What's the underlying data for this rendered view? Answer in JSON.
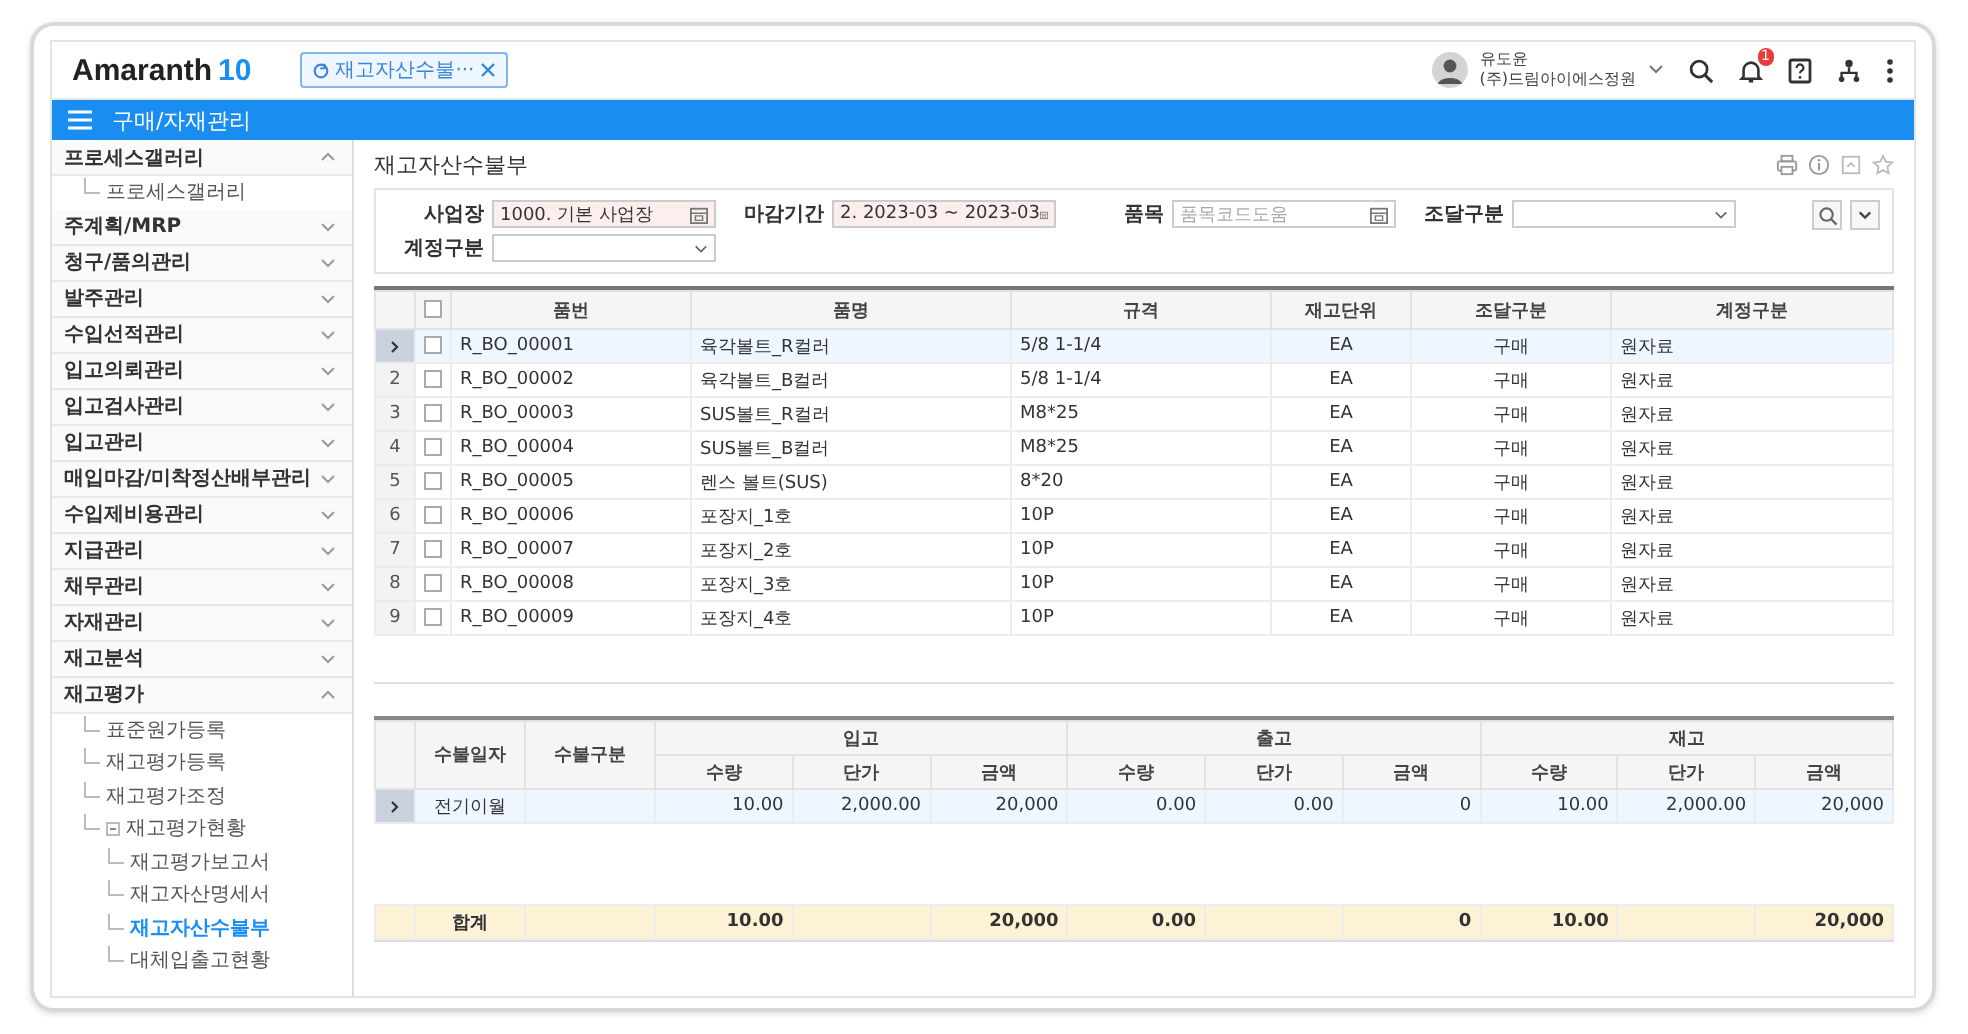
{
  "app": {
    "logo_name": "Amaranth",
    "logo_version": "10"
  },
  "open_tab": {
    "label": "재고자산수불···"
  },
  "user": {
    "name": "유도윤",
    "company": "(주)드림아이에스정원"
  },
  "notification_count": "1",
  "module_title": "구매/자재관리",
  "sidebar": {
    "items": [
      {
        "label": "프로세스갤러리",
        "expanded": true,
        "children": [
          {
            "label": "프로세스갤러리",
            "selected": false
          }
        ]
      },
      {
        "label": "주계획/MRP",
        "expanded": false
      },
      {
        "label": "청구/품의관리",
        "expanded": false
      },
      {
        "label": "발주관리",
        "expanded": false
      },
      {
        "label": "수입선적관리",
        "expanded": false
      },
      {
        "label": "입고의뢰관리",
        "expanded": false
      },
      {
        "label": "입고검사관리",
        "expanded": false
      },
      {
        "label": "입고관리",
        "expanded": false
      },
      {
        "label": "매입마감/미착정산배부관리",
        "expanded": false
      },
      {
        "label": "수입제비용관리",
        "expanded": false
      },
      {
        "label": "지급관리",
        "expanded": false
      },
      {
        "label": "채무관리",
        "expanded": false
      },
      {
        "label": "자재관리",
        "expanded": false
      },
      {
        "label": "재고분석",
        "expanded": false
      },
      {
        "label": "재고평가",
        "expanded": true,
        "children": [
          {
            "label": "표준원가등록",
            "selected": false
          },
          {
            "label": "재고평가등록",
            "selected": false
          },
          {
            "label": "재고평가조정",
            "selected": false
          },
          {
            "label": "재고평가현황",
            "expanded": true,
            "selected": false,
            "children": [
              {
                "label": "재고평가보고서",
                "selected": false
              },
              {
                "label": "재고자산명세서",
                "selected": false
              },
              {
                "label": "재고자산수불부",
                "selected": true
              },
              {
                "label": "대체입출고현황",
                "selected": false
              }
            ]
          }
        ]
      }
    ]
  },
  "page_title": "재고자산수불부",
  "filters": [
    {
      "label": "사업장",
      "kind": "picker",
      "value": "1000. 기본 사업장",
      "required": true
    },
    {
      "label": "마감기간",
      "kind": "picker",
      "value": "2. 2023-03 ~ 2023-03",
      "required": true
    },
    {
      "label": "품목",
      "kind": "picker",
      "placeholder": "품목코드도움",
      "required": false
    },
    {
      "label": "조달구분",
      "kind": "select",
      "required": false
    },
    {
      "label": "계정구분",
      "kind": "select",
      "required": false
    }
  ],
  "items_table": {
    "columns": [
      "품번",
      "품명",
      "규격",
      "재고단위",
      "조달구분",
      "계정구분"
    ],
    "header_checked": false,
    "rows": [
      {
        "selected": true,
        "checked": false,
        "cells": [
          "R_BO_00001",
          "육각볼트_R컬러",
          "5/8 1-1/4",
          "EA",
          "구매",
          "원자료"
        ]
      },
      {
        "no": "2",
        "selected": false,
        "checked": false,
        "cells": [
          "R_BO_00002",
          "육각볼트_B컬러",
          "5/8 1-1/4",
          "EA",
          "구매",
          "원자료"
        ]
      },
      {
        "no": "3",
        "selected": false,
        "checked": false,
        "cells": [
          "R_BO_00003",
          "SUS볼트_R컬러",
          "M8*25",
          "EA",
          "구매",
          "원자료"
        ]
      },
      {
        "no": "4",
        "selected": false,
        "checked": false,
        "cells": [
          "R_BO_00004",
          "SUS볼트_B컬러",
          "M8*25",
          "EA",
          "구매",
          "원자료"
        ]
      },
      {
        "no": "5",
        "selected": false,
        "checked": false,
        "cells": [
          "R_BO_00005",
          "렌스 볼트(SUS)",
          "8*20",
          "EA",
          "구매",
          "원자료"
        ]
      },
      {
        "no": "6",
        "selected": false,
        "checked": false,
        "cells": [
          "R_BO_00006",
          "포장지_1호",
          "10P",
          "EA",
          "구매",
          "원자료"
        ]
      },
      {
        "no": "7",
        "selected": false,
        "checked": false,
        "cells": [
          "R_BO_00007",
          "포장지_2호",
          "10P",
          "EA",
          "구매",
          "원자료"
        ]
      },
      {
        "no": "8",
        "selected": false,
        "checked": false,
        "cells": [
          "R_BO_00008",
          "포장지_3호",
          "10P",
          "EA",
          "구매",
          "원자료"
        ]
      },
      {
        "no": "9",
        "selected": false,
        "checked": false,
        "cells": [
          "R_BO_00009",
          "포장지_4호",
          "10P",
          "EA",
          "구매",
          "원자료"
        ]
      }
    ]
  },
  "ledger_table": {
    "lead_columns": [
      "수불일자",
      "수불구분"
    ],
    "groups": [
      {
        "label": "입고",
        "columns": [
          "수량",
          "단가",
          "금액"
        ]
      },
      {
        "label": "출고",
        "columns": [
          "수량",
          "단가",
          "금액"
        ]
      },
      {
        "label": "재고",
        "columns": [
          "수량",
          "단가",
          "금액"
        ]
      }
    ],
    "rows": [
      {
        "selected": true,
        "cells": {
          "date": "전기이월",
          "in_qty": "10.00",
          "in_price": "2,000.00",
          "in_amount": "20,000",
          "out_qty": "0.00",
          "out_price": "0.00",
          "out_amount": "0",
          "stock_qty": "10.00",
          "stock_price": "2,000.00",
          "stock_amount": "20,000"
        }
      }
    ],
    "totals": {
      "date": "합계",
      "in_qty": "10.00",
      "in_amount": "20,000",
      "out_qty": "0.00",
      "out_amount": "0",
      "stock_qty": "10.00",
      "stock_amount": "20,000"
    }
  }
}
